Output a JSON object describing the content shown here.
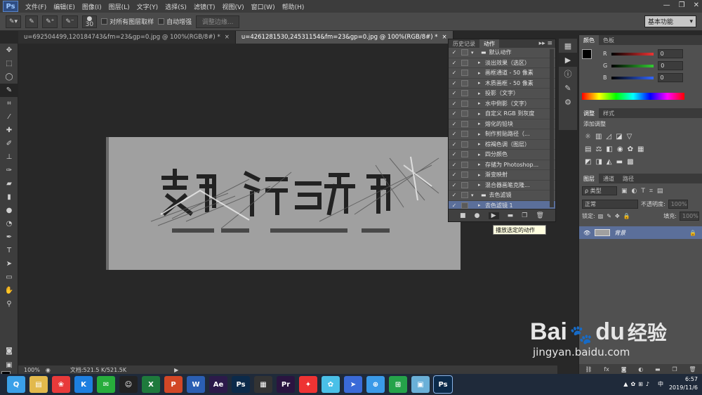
{
  "menubar": {
    "logo": "Ps",
    "items": [
      "文件(F)",
      "编辑(E)",
      "图像(I)",
      "图层(L)",
      "文字(Y)",
      "选择(S)",
      "滤镜(T)",
      "视图(V)",
      "窗口(W)",
      "帮助(H)"
    ],
    "win_controls": [
      "—",
      "❐",
      "✕"
    ]
  },
  "options": {
    "brush_size": "30",
    "sample_all": "对所有图层取样",
    "auto_enhance": "自动增强",
    "refine_edge": "调整边缘...",
    "workspace": "基本功能"
  },
  "tabs": [
    {
      "label": "u=692504499,120184743&fm=23&gp=0.jpg @ 100%(RGB/8#) *",
      "close": "×"
    },
    {
      "label": "u=4261281530,24531154&fm=23&gp=0.jpg @ 100%(RGB/8#) *",
      "close": "×"
    }
  ],
  "status": {
    "zoom": "100%",
    "doc": "文档:521.5 K/521.5K"
  },
  "actions_panel": {
    "tabs": [
      "历史记录",
      "动作"
    ],
    "rows": [
      {
        "label": "默认动作",
        "folder": true
      },
      {
        "label": "淡出效果（选区）"
      },
      {
        "label": "画框通道 - 50 像素"
      },
      {
        "label": "木质画框 - 50 像素"
      },
      {
        "label": "投影（文字）"
      },
      {
        "label": "水中倒影（文字）"
      },
      {
        "label": "自定义 RGB 到灰度"
      },
      {
        "label": "熔化的铅块"
      },
      {
        "label": "制作剪贴路径（..."
      },
      {
        "label": "棕褐色调（图层）"
      },
      {
        "label": "四分颜色"
      },
      {
        "label": "存储为 Photoshop..."
      },
      {
        "label": "渐变映射"
      },
      {
        "label": "混合器画笔克隆..."
      },
      {
        "label": "去色滤镜",
        "folder": true
      },
      {
        "label": "去色滤镜 1",
        "selected": true
      }
    ],
    "tooltip": "播放选定的动作"
  },
  "color_panel": {
    "tabs": [
      "颜色",
      "色板"
    ],
    "channels": [
      {
        "name": "R",
        "value": "0",
        "color": "#e33"
      },
      {
        "name": "G",
        "value": "0",
        "color": "#3c3"
      },
      {
        "name": "B",
        "value": "0",
        "color": "#36f"
      }
    ]
  },
  "adjust_panel": {
    "tabs": [
      "调整",
      "样式"
    ],
    "title": "添加调整"
  },
  "layers_panel": {
    "tabs": [
      "图层",
      "通道",
      "路径"
    ],
    "filter": "ρ 类型",
    "blend": "正常",
    "opacity_label": "不透明度:",
    "opacity": "100%",
    "lock_label": "锁定:",
    "fill_label": "填充:",
    "fill": "100%",
    "layer_name": "背景"
  },
  "taskbar": {
    "apps": [
      {
        "label": "Q",
        "color": "#3aa0e8"
      },
      {
        "label": "▤",
        "color": "#e2b94c"
      },
      {
        "label": "❀",
        "color": "#e83a3a"
      },
      {
        "label": "K",
        "color": "#1d7fe0"
      },
      {
        "label": "✉",
        "color": "#27ad3c"
      },
      {
        "label": "☺",
        "color": "#222"
      },
      {
        "label": "X",
        "color": "#1e7a3c"
      },
      {
        "label": "P",
        "color": "#d24726"
      },
      {
        "label": "W",
        "color": "#2b5fb3"
      },
      {
        "label": "Ae",
        "color": "#2c1a4a"
      },
      {
        "label": "Ps",
        "color": "#0b2a4a"
      },
      {
        "label": "▦",
        "color": "#333"
      },
      {
        "label": "Pr",
        "color": "#2a1440"
      },
      {
        "label": "✦",
        "color": "#e33"
      },
      {
        "label": "✿",
        "color": "#4ac0e8"
      },
      {
        "label": "➤",
        "color": "#3a6ad8"
      },
      {
        "label": "⊕",
        "color": "#3a9ae8"
      },
      {
        "label": "⊞",
        "color": "#25a34a"
      },
      {
        "label": "▣",
        "color": "#6ab0d8"
      },
      {
        "label": "Ps",
        "color": "#0b2a4a"
      }
    ],
    "tray_text": "中",
    "time": "6:57",
    "date": "2019/11/6"
  },
  "watermark": {
    "brand": "Bai",
    "brand2": "du",
    "cn": "经验",
    "url": "jingyan.baidu.com"
  }
}
